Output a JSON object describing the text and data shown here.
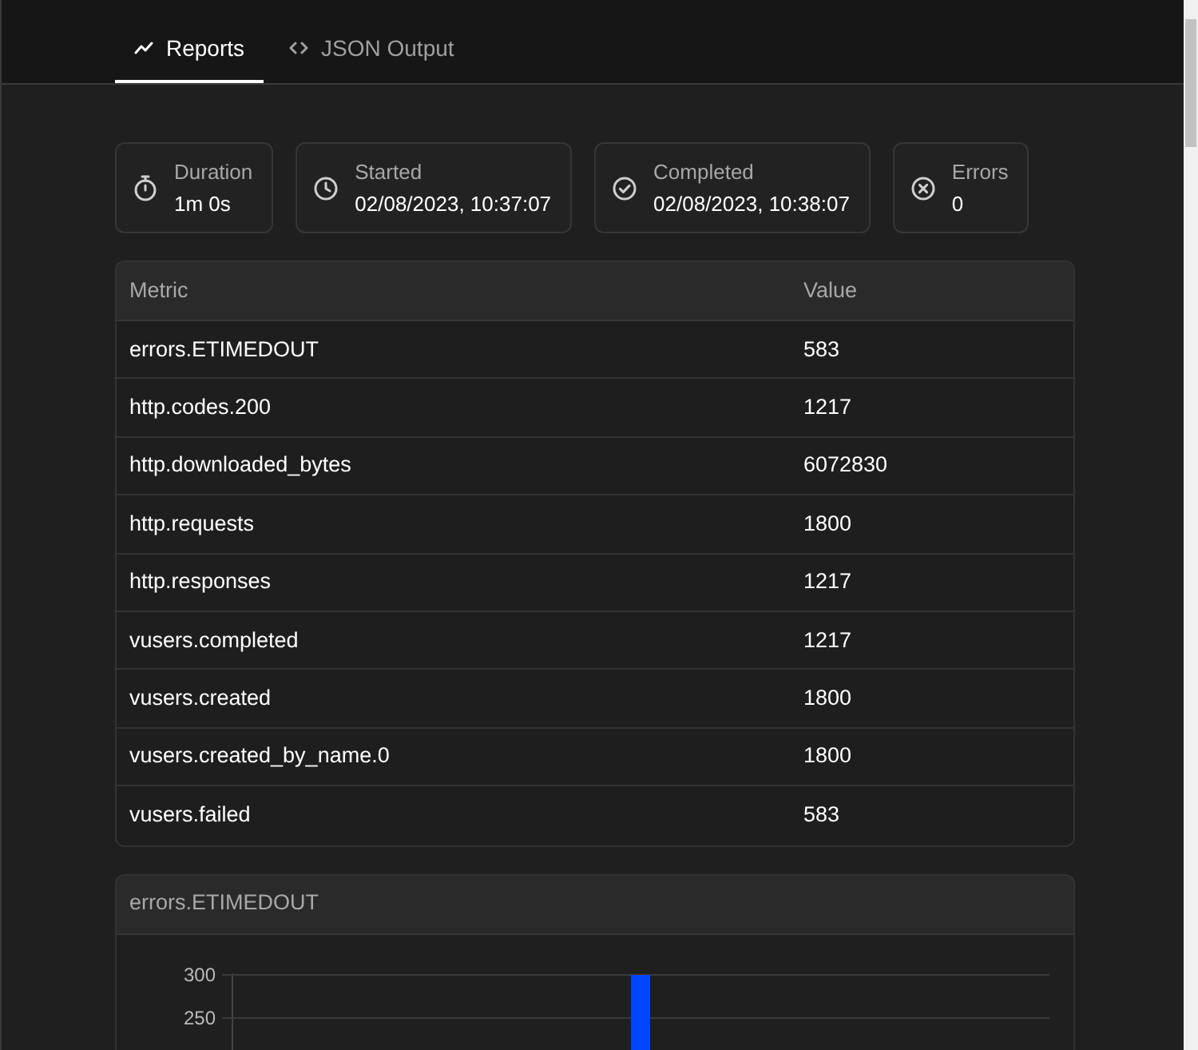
{
  "tabs": [
    {
      "label": "Reports",
      "selected": true
    },
    {
      "label": "JSON Output",
      "selected": false
    }
  ],
  "summary": [
    {
      "label": "Duration",
      "value": "1m 0s"
    },
    {
      "label": "Started",
      "value": "02/08/2023, 10:37:07"
    },
    {
      "label": "Completed",
      "value": "02/08/2023, 10:38:07"
    },
    {
      "label": "Errors",
      "value": "0"
    }
  ],
  "table": {
    "columns": [
      "Metric",
      "Value"
    ],
    "rows": [
      [
        "errors.ETIMEDOUT",
        "583"
      ],
      [
        "http.codes.200",
        "1217"
      ],
      [
        "http.downloaded_bytes",
        "6072830"
      ],
      [
        "http.requests",
        "1800"
      ],
      [
        "http.responses",
        "1217"
      ],
      [
        "vusers.completed",
        "1217"
      ],
      [
        "vusers.created",
        "1800"
      ],
      [
        "vusers.created_by_name.0",
        "1800"
      ],
      [
        "vusers.failed",
        "583"
      ]
    ]
  },
  "chart_panel": {
    "title": "errors.ETIMEDOUT",
    "y_axis_labels": [
      "300",
      "250"
    ]
  }
}
